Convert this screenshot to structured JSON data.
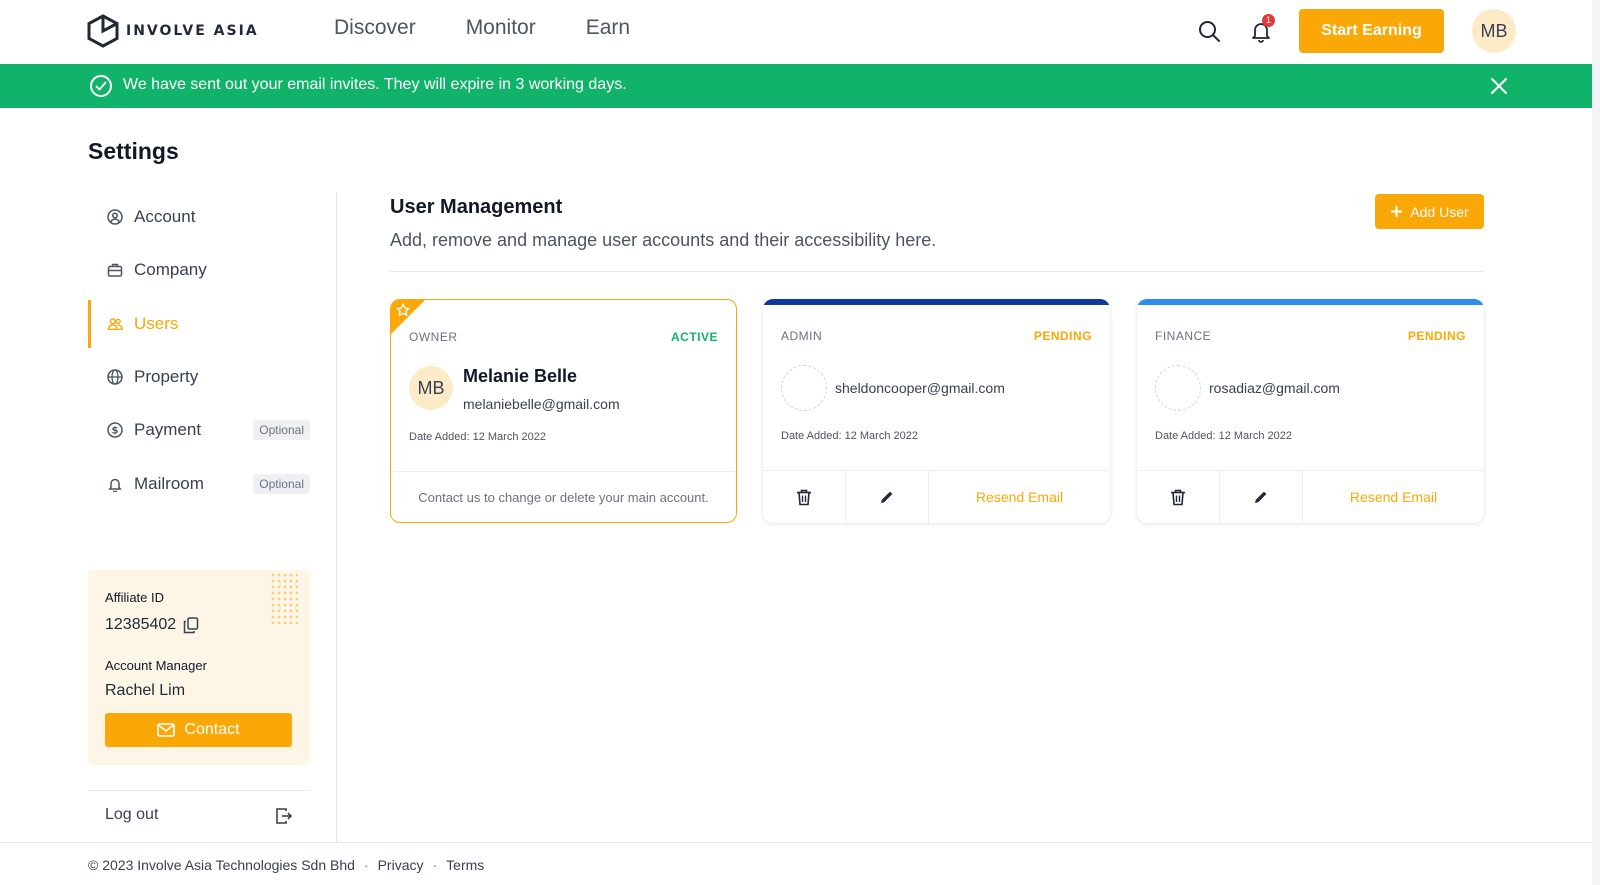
{
  "header": {
    "logo_text": "INVOLVE ASIA",
    "nav": [
      "Discover",
      "Monitor",
      "Earn"
    ],
    "notification_count": "1",
    "start_earning_label": "Start Earning",
    "avatar_initials": "MB"
  },
  "banner": {
    "message": "We have sent out your email invites. They will expire in 3 working days.",
    "color": "#11b36a"
  },
  "settings": {
    "title": "Settings",
    "sidebar": [
      {
        "label": "Account",
        "icon": "user-circle-icon"
      },
      {
        "label": "Company",
        "icon": "briefcase-icon"
      },
      {
        "label": "Users",
        "icon": "users-icon",
        "active": true
      },
      {
        "label": "Property",
        "icon": "globe-icon"
      },
      {
        "label": "Payment",
        "icon": "dollar-circle-icon",
        "badge": "Optional"
      },
      {
        "label": "Mailroom",
        "icon": "bell-icon",
        "badge": "Optional"
      }
    ],
    "affiliate": {
      "id_label": "Affiliate ID",
      "id_value": "12385402",
      "manager_label": "Account Manager",
      "manager_name": "Rachel Lim",
      "contact_label": "Contact"
    },
    "logout_label": "Log out"
  },
  "user_management": {
    "title": "User Management",
    "subtitle": "Add, remove and manage user accounts and their accessibility here.",
    "add_user_label": "Add User",
    "cards": [
      {
        "role": "OWNER",
        "status": "ACTIVE",
        "status_color": "#11b36a",
        "initials": "MB",
        "name": "Melanie Belle",
        "email": "melaniebelle@gmail.com",
        "date_added": "Date Added: 12 March 2022",
        "note": "Contact us to change or delete your main account."
      },
      {
        "role": "ADMIN",
        "status": "PENDING",
        "status_color": "#f9a807",
        "bar_color": "#0d3a9a",
        "email": "sheldoncooper@gmail.com",
        "date_added": "Date Added: 12 March 2022",
        "resend_label": "Resend Email"
      },
      {
        "role": "FINANCE",
        "status": "PENDING",
        "status_color": "#f9a807",
        "bar_color": "#2d8ef0",
        "email": "rosadiaz@gmail.com",
        "date_added": "Date Added: 12 March 2022",
        "resend_label": "Resend Email"
      }
    ]
  },
  "footer": {
    "copyright": "© 2023 Involve Asia Technologies Sdn Bhd",
    "links": [
      "Privacy",
      "Terms"
    ]
  },
  "colors": {
    "accent": "#f9a807",
    "success": "#11b36a"
  }
}
